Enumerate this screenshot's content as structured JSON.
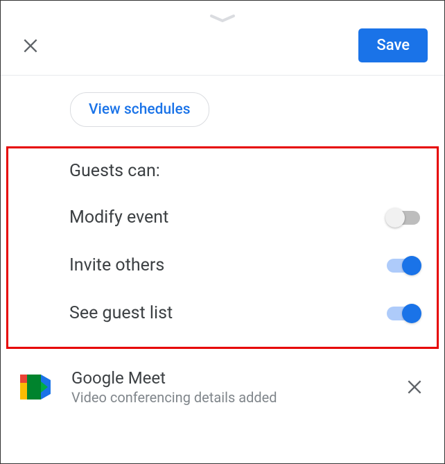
{
  "header": {
    "save_label": "Save"
  },
  "schedules": {
    "button_label": "View schedules"
  },
  "guests": {
    "title": "Guests can:",
    "permissions": [
      {
        "label": "Modify event",
        "enabled": false
      },
      {
        "label": "Invite others",
        "enabled": true
      },
      {
        "label": "See guest list",
        "enabled": true
      }
    ]
  },
  "meet": {
    "title": "Google Meet",
    "subtitle": "Video conferencing details added"
  }
}
